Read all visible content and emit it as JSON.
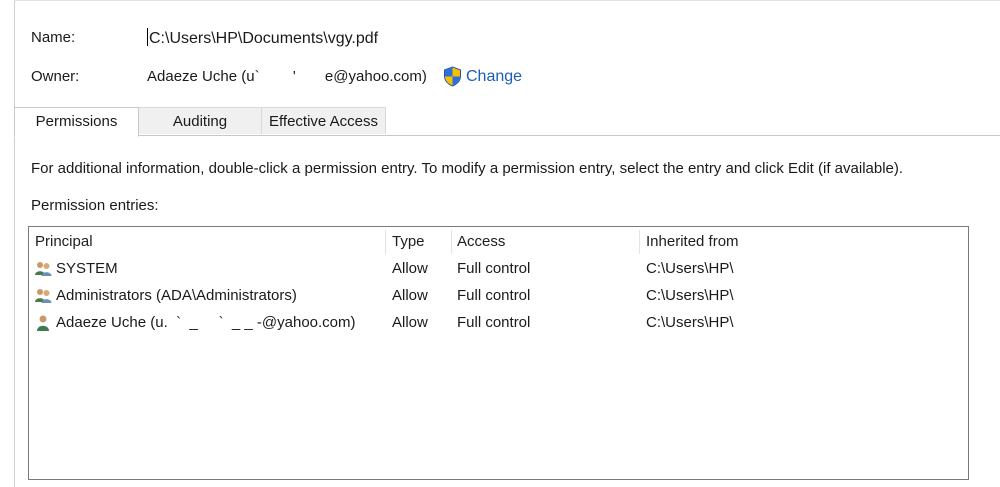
{
  "name": {
    "label": "Name:",
    "value": "C:\\Users\\HP\\Documents\\vgy.pdf"
  },
  "owner": {
    "label": "Owner:",
    "value": "Adaeze Uche (u`        '       e@yahoo.com)",
    "change_label": "Change"
  },
  "tabs": [
    {
      "label": "Permissions",
      "active": true
    },
    {
      "label": "Auditing",
      "active": false
    },
    {
      "label": "Effective Access",
      "active": false
    }
  ],
  "info_text": "For additional information, double-click a permission entry. To modify a permission entry, select the entry and click Edit (if available).",
  "entries_label": "Permission entries:",
  "table": {
    "columns": [
      "Principal",
      "Type",
      "Access",
      "Inherited from"
    ],
    "rows": [
      {
        "principal": "SYSTEM",
        "type": "Allow",
        "access": "Full control",
        "inherited": "C:\\Users\\HP\\",
        "icon": "group-users-icon"
      },
      {
        "principal": "Administrators (ADA\\Administrators)",
        "type": "Allow",
        "access": "Full control",
        "inherited": "C:\\Users\\HP\\",
        "icon": "group-users-icon"
      },
      {
        "principal": "Adaeze Uche (u.  `  _     `  _ _ ‑@yahoo.com)",
        "type": "Allow",
        "access": "Full control",
        "inherited": "C:\\Users\\HP\\",
        "icon": "user-icon"
      }
    ]
  },
  "colors": {
    "link": "#1a5fb4",
    "shield_blue": "#2f6fd6",
    "shield_yellow": "#f5c000"
  }
}
